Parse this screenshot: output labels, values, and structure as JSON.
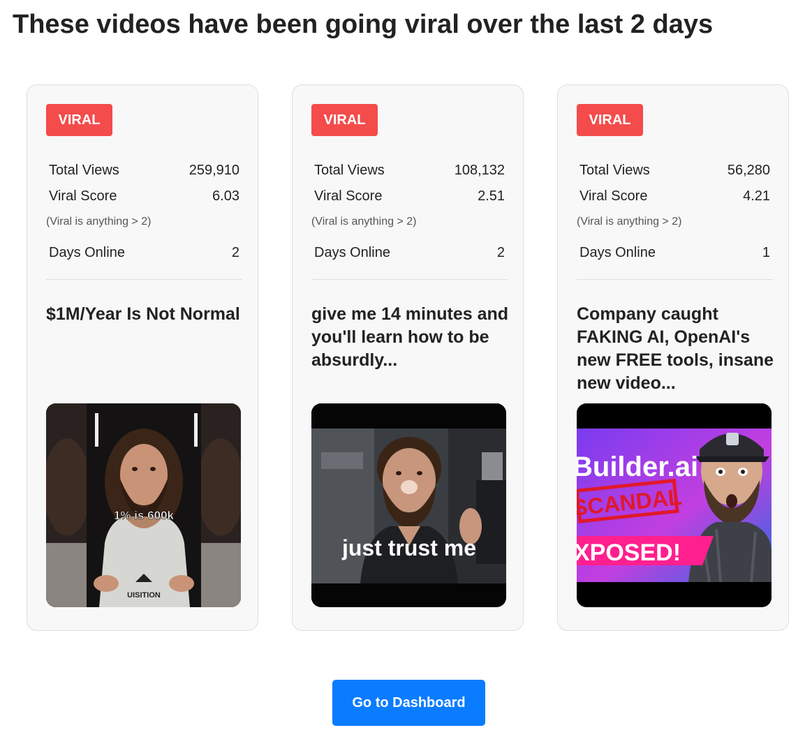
{
  "page": {
    "title": "These videos have been going viral over the last 2 days"
  },
  "videos": [
    {
      "badge": "VIRAL",
      "stats": {
        "views_label": "Total Views",
        "views_value": "259,910",
        "score_label": "Viral Score",
        "score_value": "6.03",
        "note": "(Viral is anything > 2)",
        "days_label": "Days Online",
        "days_value": "2"
      },
      "title": "$1M/Year Is Not Normal",
      "thumbnail": {
        "caption": "1% is 600k",
        "shirt_text": "UISITION"
      }
    },
    {
      "badge": "VIRAL",
      "stats": {
        "views_label": "Total Views",
        "views_value": "108,132",
        "score_label": "Viral Score",
        "score_value": "2.51",
        "note": "(Viral is anything > 2)",
        "days_label": "Days Online",
        "days_value": "2"
      },
      "title": "give me 14 minutes and you'll learn how to be absurdly...",
      "thumbnail": {
        "caption": "just trust me"
      }
    },
    {
      "badge": "VIRAL",
      "stats": {
        "views_label": "Total Views",
        "views_value": "56,280",
        "score_label": "Viral Score",
        "score_value": "4.21",
        "note": "(Viral is anything > 2)",
        "days_label": "Days Online",
        "days_value": "1"
      },
      "title": "Company caught FAKING AI, OpenAI's new FREE tools, insane new video...",
      "thumbnail": {
        "brand": "Builder.ai",
        "stamp": "SCANDAL",
        "banner": "XPOSED!"
      }
    }
  ],
  "footer": {
    "button_label": "Go to Dashboard"
  },
  "colors": {
    "badge": "#f44b4b",
    "button": "#0a7cff",
    "card_bg": "#f8f8f8"
  }
}
